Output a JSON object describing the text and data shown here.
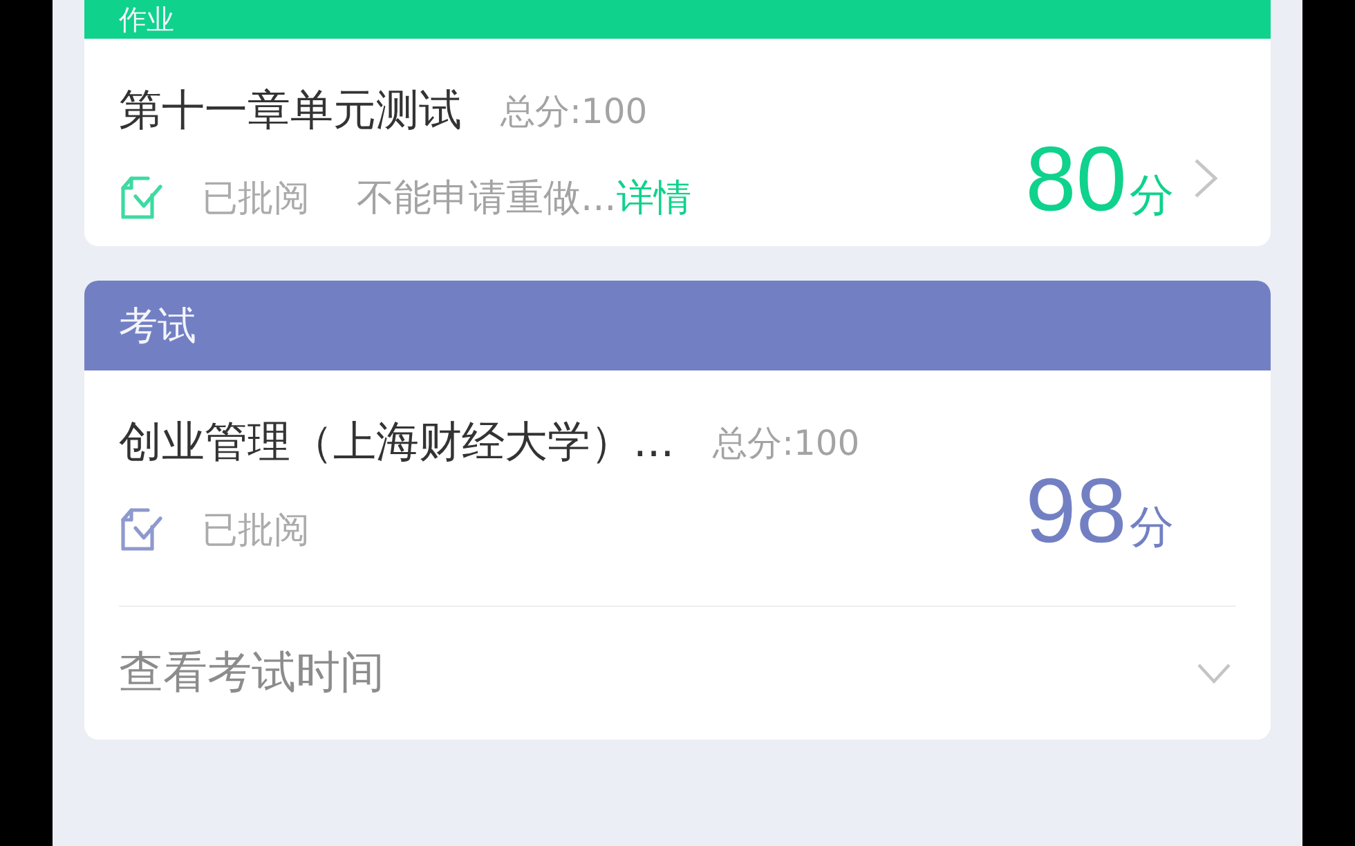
{
  "sections": [
    {
      "kind": "homework",
      "header": "作业",
      "color": "#0fd28c",
      "title": "第十一章单元测试",
      "total": "总分:100",
      "status": "已批阅",
      "note": "不能申请重做...",
      "link": "详情",
      "score": "80",
      "unit": "分"
    },
    {
      "kind": "exam",
      "header": "考试",
      "color": "#7280c3",
      "title": "创业管理（上海财经大学）...",
      "total": "总分:100",
      "status": "已批阅",
      "score": "98",
      "unit": "分",
      "footer": {
        "label": "查看考试时间",
        "expanded": false
      }
    }
  ]
}
